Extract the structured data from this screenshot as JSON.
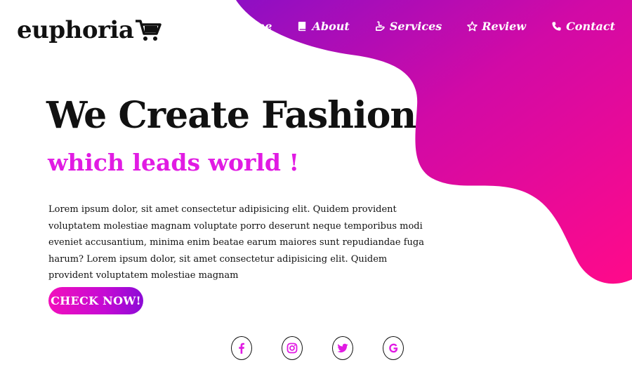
{
  "brand": {
    "name": "euphoria"
  },
  "nav": {
    "items": [
      {
        "label": "Home",
        "icon": "home-icon"
      },
      {
        "label": "About",
        "icon": "book-icon"
      },
      {
        "label": "Services",
        "icon": "services-icon"
      },
      {
        "label": "Review",
        "icon": "star-icon"
      },
      {
        "label": "Contact",
        "icon": "phone-icon"
      }
    ]
  },
  "hero": {
    "title": "We Create Fashion",
    "subtitle": "which leads world !",
    "body": "Lorem ipsum dolor, sit amet consectetur adipisicing elit. Quidem provident voluptatem molestiae magnam voluptate porro deserunt neque temporibus modi eveniet accusantium, minima enim beatae earum maiores sunt repudiandae fuga harum? Lorem ipsum dolor, sit amet consectetur adipisicing elit. Quidem provident voluptatem molestiae magnam",
    "cta_label": "CHECK NOW!"
  },
  "socials": [
    {
      "icon": "facebook-icon"
    },
    {
      "icon": "instagram-icon"
    },
    {
      "icon": "twitter-icon"
    },
    {
      "icon": "google-icon"
    }
  ],
  "colors": {
    "accent_magenta": "#e11be3",
    "blob_purple": "#8e0fc4",
    "blob_pink": "#ff0a8a",
    "text_dark": "#111111"
  }
}
